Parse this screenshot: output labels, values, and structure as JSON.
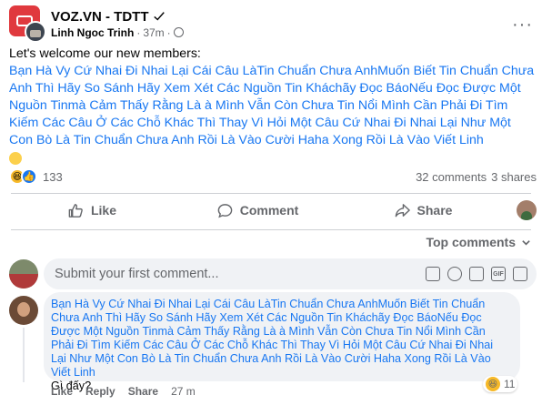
{
  "header": {
    "group_name": "VOZ.VN - TDTT",
    "author": "Linh Ngoc Trinh",
    "dot": "·",
    "time": "37m",
    "more": "···"
  },
  "post": {
    "intro": "Let's welcome our new members:",
    "members_text": "Bạn Hà Vy Cứ Nhai Đi Nhai Lại Cái Câu LàTin Chuẩn Chưa AnhMuốn Biết Tin Chuẩn Chưa Anh Thì Hãy So Sánh Hãy Xem Xét Các Nguồn Tin Kháchãy Đọc Báo​Nếu Đọc Được Một Nguồn Tinmà Cảm Thấy Rằng Là à Mình Vẫn Còn Chưa Tin Nổi Mình Cần Phải Đi Tìm Kiếm Các Câu Ở Các Chỗ Khác Thì Thay Vì Hỏi Một Câu Cứ Nhai Đi Nhai Lại Như Một Con Bò Là Tin Chuẩn Chưa Anh Rồi Là Vào Cười Haha Xong Rồi Là Vào Viết Linh"
  },
  "reactions": {
    "count": "133",
    "comments": "32 comments",
    "shares": "3 shares"
  },
  "actions": {
    "like": "Like",
    "comment": "Comment",
    "share": "Share"
  },
  "sort": {
    "label": "Top comments"
  },
  "composer": {
    "placeholder": "Submit your first comment..."
  },
  "comment": {
    "text": "Bạn Hà Vy Cứ Nhai Đi Nhai Lại Cái Câu LàTin Chuẩn Chưa AnhMuốn Biết Tin Chuẩn Chưa Anh Thì Hãy So Sánh Hãy Xem Xét Các Nguồn Tin Kháchãy Đọc Báo​Nếu Đọc Được Một Nguồn Tinmà Cảm Thấy Rằng Là à Mình Vẫn Còn Chưa Tin Nổi Mình Cần Phải Đi Tìm Kiếm Các Câu Ở Các Chỗ Khác Thì Thay Vì Hỏi Một Câu Cứ Nhai Đi Nhai Lại Như Một Con Bò Là Tin Chuẩn Chưa Anh Rồi Là Vào Cười Haha Xong Rồi Là Vào Viết Linh",
    "reply_text": "Gì đấy?",
    "react_count": "11",
    "like": "Like",
    "reply": "Reply",
    "share": "Share",
    "time": "27 m"
  },
  "colors": {
    "link": "#1877f2",
    "secondary": "#65676b",
    "bubble": "#f0f2f5",
    "divider": "#ced0d4"
  }
}
